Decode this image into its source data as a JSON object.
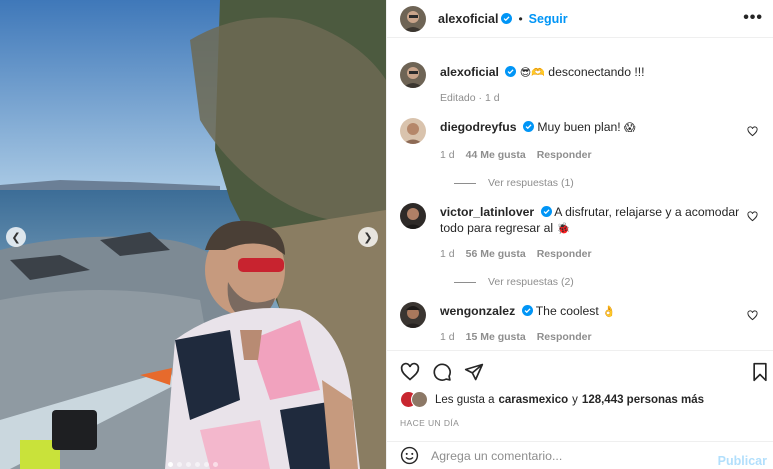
{
  "post": {
    "username": "alexoficial",
    "follow_label": "Seguir",
    "dot": "•",
    "more": "•••",
    "caption_text": "desconectando !!!",
    "caption_emojis": "😎🫶",
    "edited": "Editado · 1 d"
  },
  "comments": [
    {
      "username": "diegodreyfus",
      "text": "Muy buen plan!",
      "emoji": "😱",
      "time": "1 d",
      "likes": "44 Me gusta",
      "reply": "Responder",
      "replies": "Ver respuestas (1)"
    },
    {
      "username": "victor_latinlover",
      "text": "A disfrutar, relajarse y a acomodar todo para regresar al",
      "emoji": "🐞",
      "time": "1 d",
      "likes": "56 Me gusta",
      "reply": "Responder",
      "replies": "Ver respuestas (2)"
    },
    {
      "username": "wengonzalez",
      "text": "The coolest",
      "emoji": "👌",
      "time": "1 d",
      "likes": "15 Me gusta",
      "reply": "Responder"
    }
  ],
  "likes": {
    "prefix": "Les gusta a",
    "user": "carasmexico",
    "connector": "y",
    "count": "128,443 personas más"
  },
  "time_ago": "HACE UN DÍA",
  "comment_box": {
    "placeholder": "Agrega un comentario...",
    "publish": "Publicar"
  },
  "colors": {
    "accent": "#0095f6",
    "publish_disabled": "#b2dffc",
    "muted": "#8e8e8e"
  },
  "carousel": {
    "total_slides": 6,
    "active_index": 0
  }
}
